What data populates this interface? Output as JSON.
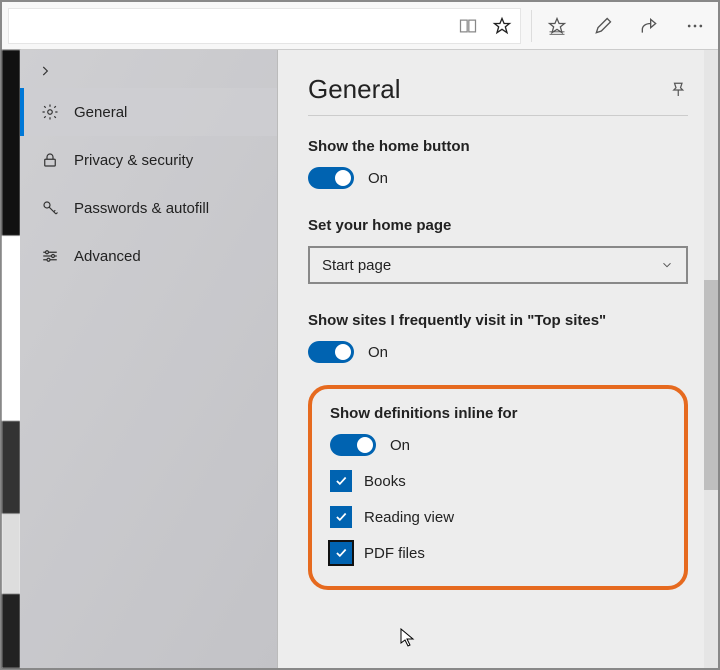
{
  "toolbar": {
    "reading_icon": "reading-view",
    "star_icon": "favorite-star",
    "favorites_icon": "favorites-list",
    "notes_icon": "add-notes",
    "share_icon": "share",
    "more_icon": "more"
  },
  "sidebar": {
    "items": [
      {
        "icon": "gear-icon",
        "label": "General",
        "active": true
      },
      {
        "icon": "lock-icon",
        "label": "Privacy & security",
        "active": false
      },
      {
        "icon": "key-icon",
        "label": "Passwords & autofill",
        "active": false
      },
      {
        "icon": "sliders-icon",
        "label": "Advanced",
        "active": false
      }
    ]
  },
  "main": {
    "title": "General",
    "pin_label": "Pin",
    "show_home_button": {
      "title": "Show the home button",
      "state": "On"
    },
    "home_page": {
      "title": "Set your home page",
      "value": "Start page"
    },
    "top_sites": {
      "title": "Show sites I frequently visit in \"Top sites\"",
      "state": "On"
    },
    "definitions": {
      "title": "Show definitions inline for",
      "state": "On",
      "options": [
        {
          "label": "Books",
          "checked": true
        },
        {
          "label": "Reading view",
          "checked": true
        },
        {
          "label": "PDF files",
          "checked": true,
          "focused": true
        }
      ]
    }
  }
}
